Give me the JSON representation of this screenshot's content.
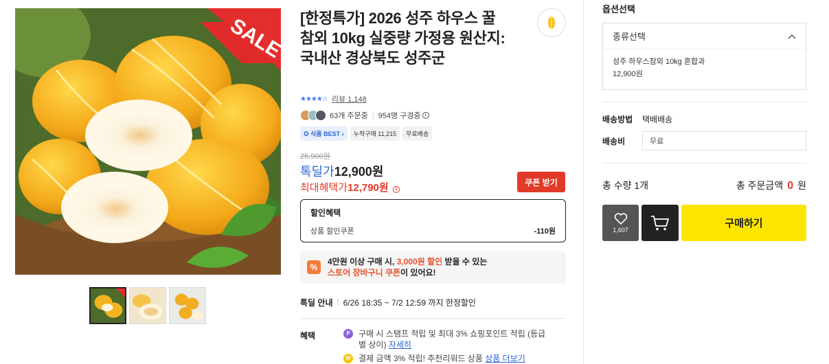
{
  "product": {
    "title": "[한정특가] 2026 성주 하우스 꿀 참외 10kg 실중량 가정용 원산지: 국내산 경상북도 성주군",
    "sale_badge": "SALE",
    "review_text": "리뷰 1,148",
    "rating": 4.5,
    "order_count": "63개 주문중",
    "subscriber_count": "954명 구경중",
    "tags": [
      "식품 BEST",
      "누적구매 11,215",
      "무료배송"
    ],
    "original_price": "25,900원",
    "price_label": "톡딜가",
    "price": "12,900원",
    "max_label": "최대혜택가",
    "max_price": "12,790원",
    "coupon_button": "쿠폰 받기"
  },
  "discount": {
    "title": "할인혜택",
    "row_label": "상품 할인쿠폰",
    "row_value": "-110원"
  },
  "promo": {
    "line1_a": "4만원 이상 구매 시, ",
    "line1_b": "3,000원 할인",
    "line1_c": " 받을 수 있는",
    "line2_a": "스토어 장바구니 쿠폰",
    "line2_b": "이 있어요!"
  },
  "deal": {
    "label": "톡딜 안내",
    "period": "6/26 18:35 ~ 7/2 12:59 까지 한정할인"
  },
  "benefits": {
    "label": "혜택",
    "b1_text": "구매 시 스탬프 적립 및 최대 3% 쇼핑포인트 적립 (등급별 상이)",
    "b1_link": "자세히",
    "b2_text": "결제 금액 3% 적립! 추천리워드 상품",
    "b2_link": "상품 더보기"
  },
  "options": {
    "title": "옵션선택",
    "dropdown_label": "종류선택",
    "selected_name": "성주 하우스참외 10kg 혼합과",
    "selected_price": "12,900원"
  },
  "shipping": {
    "method_label": "배송방법",
    "method_value": "택배배송",
    "fee_label": "배송비",
    "fee_value": "무료"
  },
  "total": {
    "qty_label": "총 수량 1개",
    "amount_label": "총 주문금액",
    "amount": "0",
    "unit": "원"
  },
  "actions": {
    "wish_count": "1,607",
    "buy_label": "구매하기"
  },
  "colors": {
    "accent_blue": "#2a63d4",
    "sale_red": "#e43a2a",
    "buy_yellow": "#fee500"
  }
}
